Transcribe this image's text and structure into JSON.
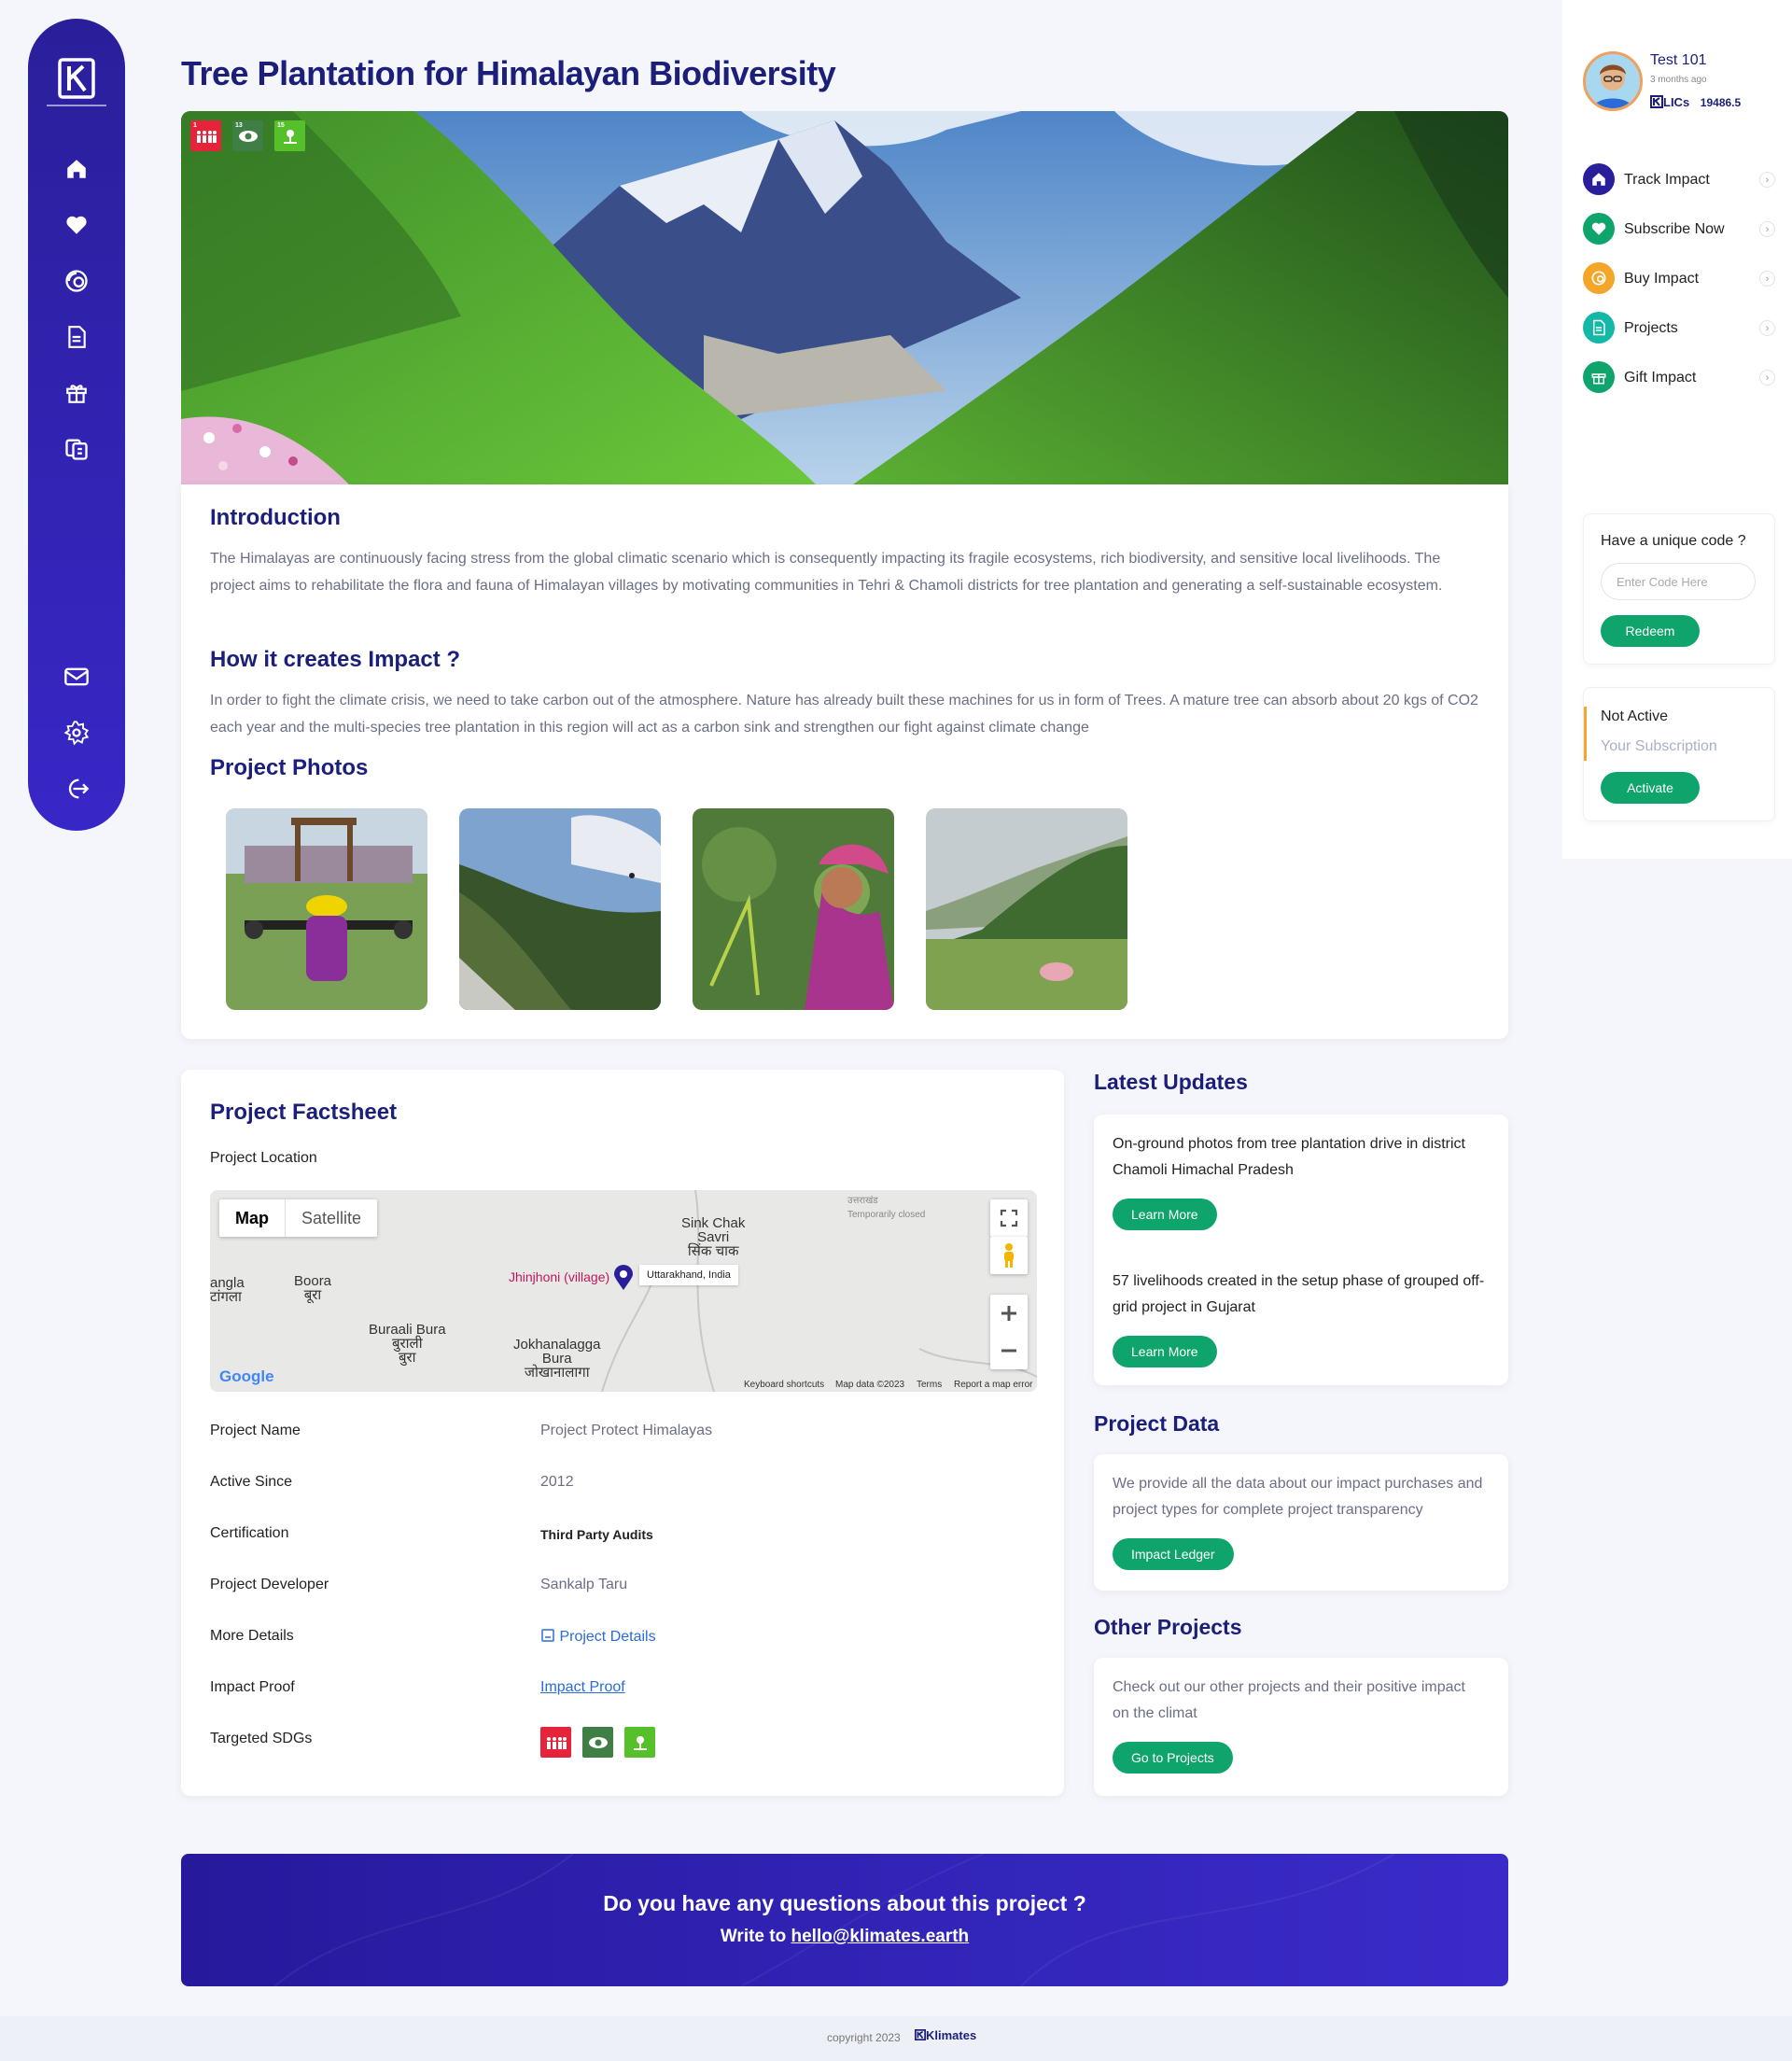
{
  "page": {
    "title": "Tree Plantation for Himalayan Biodiversity"
  },
  "hero": {
    "sdgs": [
      {
        "num": "1",
        "color": "#e5243b",
        "icon": "people-icon"
      },
      {
        "num": "13",
        "color": "#3f7e44",
        "icon": "eye-icon"
      },
      {
        "num": "15",
        "color": "#56c02b",
        "icon": "tree-icon"
      }
    ]
  },
  "intro": {
    "title": "Introduction",
    "text": "The Himalayas are continuously facing stress from the global climatic scenario which is consequently impacting its fragile ecosystems, rich biodiversity, and sensitive local livelihoods. The project aims to rehabilitate the flora and fauna of Himalayan villages by motivating communities in Tehri & Chamoli districts for tree plantation and generating a self-sustainable ecosystem.",
    "impact_title": "How it creates Impact ?",
    "impact_text": "In order to fight the climate crisis, we need to take carbon out of the atmosphere. Nature has already built these machines for us in form of Trees. A mature tree can absorb about 20 kgs of CO2 each year and the multi-species tree plantation in this region will act as a carbon sink and strengthen our fight against climate change",
    "photos_title": "Project Photos"
  },
  "factsheet": {
    "title": "Project Factsheet",
    "location_label": "Project Location",
    "map": {
      "tab_map": "Map",
      "tab_satellite": "Satellite",
      "labels": {
        "sink_chak": "Sink Chak",
        "savri": "Savri",
        "sink_chak_hi": "सिंक चाक",
        "angla": "angla",
        "angla_hi": "टांगला",
        "boora": "Boora",
        "boora_hi": "बूरा",
        "buraali": "Buraali Bura",
        "buraali_hi1": "बुराली",
        "buraali_hi2": "बुरा",
        "jokha": "Jokhanalagga",
        "jokha2": "Bura",
        "jokha_hi": "जोखानालागा",
        "pin": "Jhinjhoni (village)",
        "pin_popup": "Uttarakhand, India",
        "closed_hi": "उत्तराखंड",
        "closed": "Temporarily closed"
      },
      "google": "Google",
      "footer": {
        "shortcuts": "Keyboard shortcuts",
        "data": "Map data ©2023",
        "terms": "Terms",
        "report": "Report a map error"
      }
    },
    "rows": {
      "name_k": "Project Name",
      "name_v": "Project Protect Himalayas",
      "since_k": "Active Since",
      "since_v": "2012",
      "cert_k": "Certification",
      "cert_v": "Third Party Audits",
      "dev_k": "Project Developer",
      "dev_v": "Sankalp Taru",
      "more_k": "More Details",
      "more_v": "Project Details",
      "proof_k": "Impact Proof",
      "proof_v": "Impact Proof",
      "sdg_k": "Targeted SDGs"
    }
  },
  "updates": {
    "title": "Latest Updates",
    "items": [
      {
        "text": "On-ground photos from tree plantation drive in district Chamoli Himachal Pradesh",
        "button": "Learn More"
      },
      {
        "text": "57 livelihoods created in the setup phase of grouped off-grid project in Gujarat",
        "button": "Learn More"
      }
    ]
  },
  "project_data": {
    "title": "Project Data",
    "text": "We provide all the data about our impact purchases and project types for complete project transparency",
    "button": "Impact Ledger"
  },
  "other_projects": {
    "title": "Other Projects",
    "text": "Check out our other projects and their positive impact on the climat",
    "button": "Go to Projects"
  },
  "cta": {
    "question": "Do you have any questions about this project ?",
    "write_prefix": "Write to ",
    "email": "hello@klimates.earth"
  },
  "footer": {
    "copyright": "copyright 2023",
    "brand": "Klimates"
  },
  "user": {
    "name": "Test 101",
    "time": "3 months ago",
    "coin_label": "LICs",
    "coins": "19486.5"
  },
  "right_nav": [
    {
      "label": "Track Impact",
      "color": "#2a1f9a",
      "icon": "home-icon"
    },
    {
      "label": "Subscribe Now",
      "color": "#0ea46b",
      "icon": "heart-icon"
    },
    {
      "label": "Buy Impact",
      "color": "#f4a52a",
      "icon": "coins-icon"
    },
    {
      "label": "Projects",
      "color": "#13b8a6",
      "icon": "document-icon"
    },
    {
      "label": "Gift Impact",
      "color": "#0ea46b",
      "icon": "gift-icon"
    }
  ],
  "redeem": {
    "title": "Have a unique code ?",
    "placeholder": "Enter Code Here",
    "button": "Redeem"
  },
  "subscription": {
    "status": "Not Active",
    "label": "Your Subscription",
    "button": "Activate"
  },
  "colors": {
    "brand": "#2a1f9a",
    "accent_green": "#0ea46b",
    "title": "#1b1f7a"
  }
}
